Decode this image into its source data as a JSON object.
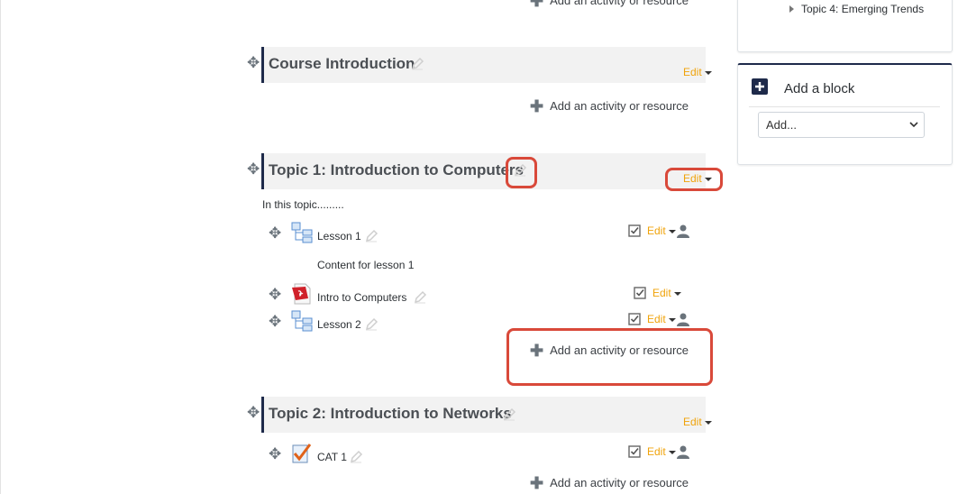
{
  "sections": [
    {
      "title": "Course Introduction",
      "edit_label": "Edit",
      "add_label": "Add an activity or resource"
    },
    {
      "title": "Topic 1: Introduction to Computers",
      "edit_label": "Edit",
      "summary": "In this topic.........",
      "add_label": "Add an activity or resource",
      "activities": [
        {
          "name": "Lesson 1",
          "type": "lesson",
          "edit_label": "Edit",
          "description": "Content for lesson 1"
        },
        {
          "name": "Intro to Computers",
          "type": "pdf",
          "edit_label": "Edit"
        },
        {
          "name": "Lesson 2",
          "type": "lesson",
          "edit_label": "Edit"
        }
      ]
    },
    {
      "title": "Topic 2: Introduction to Networks",
      "edit_label": "Edit",
      "add_label": "Add an activity or resource",
      "activities": [
        {
          "name": "CAT 1",
          "type": "quiz",
          "edit_label": "Edit"
        }
      ]
    }
  ],
  "top_add_label": "Add an activity or resource",
  "navigation": {
    "last_item": "Topic 4: Emerging Trends"
  },
  "add_block": {
    "title": "Add a block",
    "select_value": "Add..."
  },
  "colors": {
    "accent": "#f0a30a",
    "highlight": "#d9493a",
    "header_bg": "#f2f2f2",
    "nav_border": "#1e2a4a"
  }
}
